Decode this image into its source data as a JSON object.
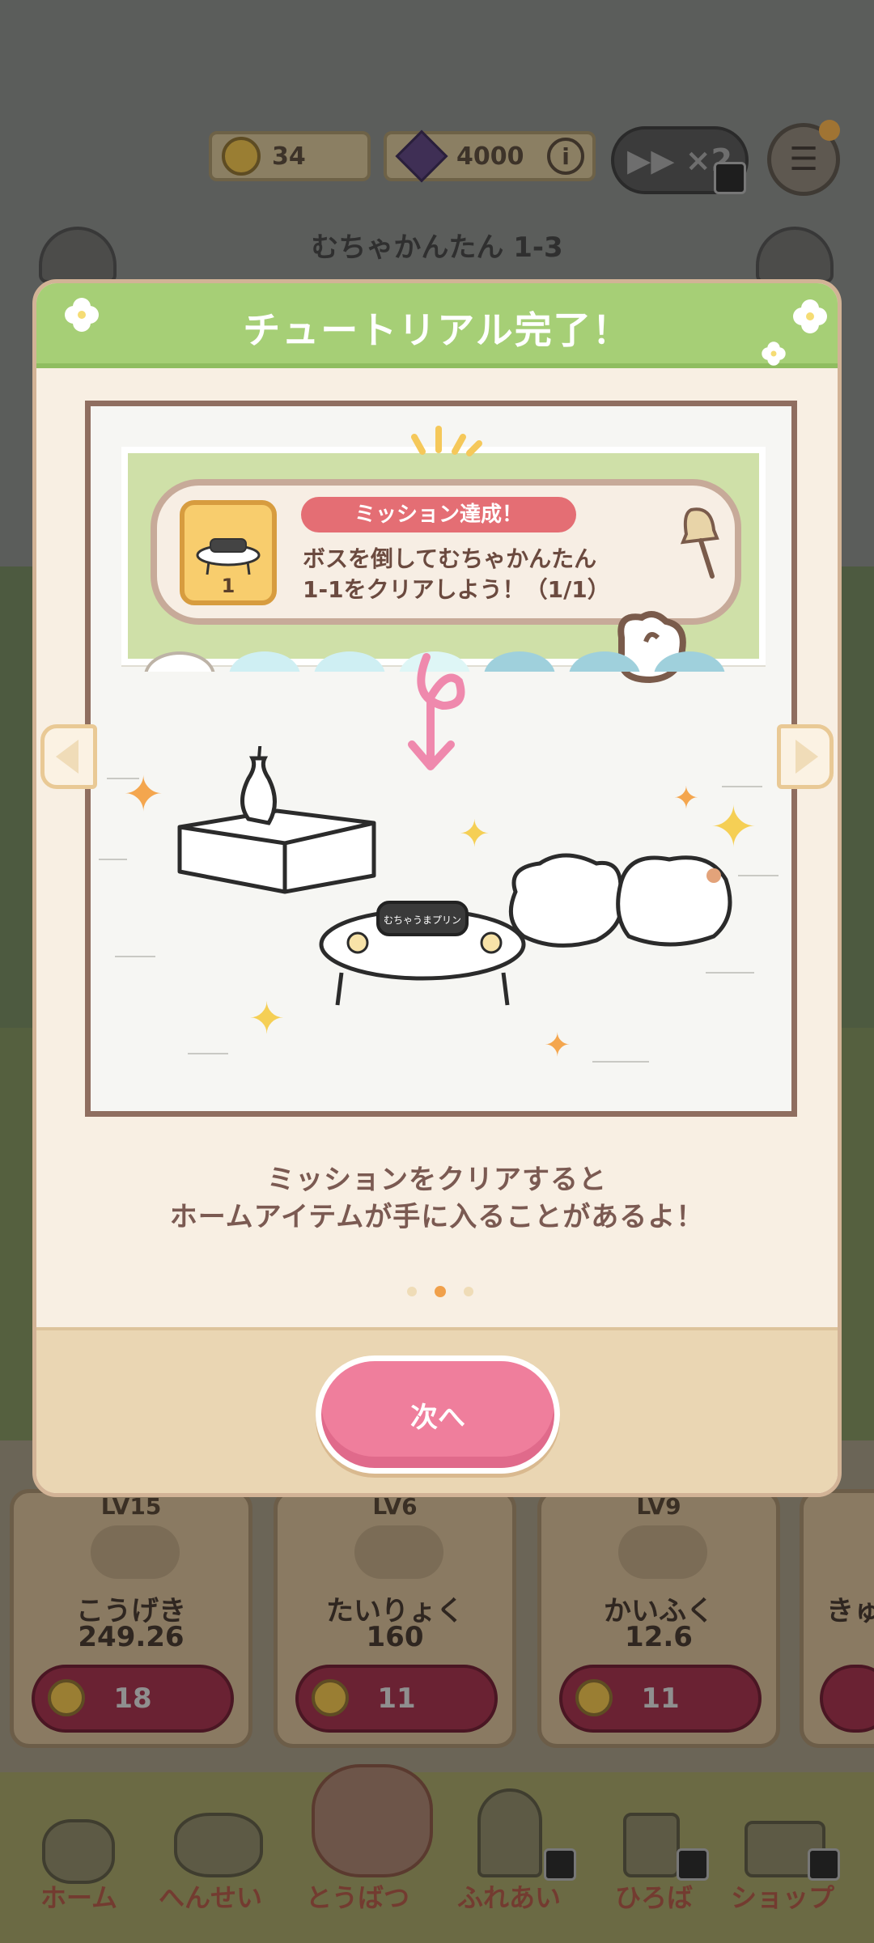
{
  "hud": {
    "coins": "34",
    "gems": "4000",
    "info_glyph": "i",
    "speed_label": "▶▶ ×2",
    "stage_title": "むちゃかんたん 1-3"
  },
  "stat_cards": [
    {
      "level": "LV15",
      "name": "こうげき",
      "value": "249.26",
      "cost": "18"
    },
    {
      "level": "LV6",
      "name": "たいりょく",
      "value": "160",
      "cost": "11"
    },
    {
      "level": "LV9",
      "name": "かいふく",
      "value": "12.6",
      "cost": "11"
    },
    {
      "level": "",
      "name": "きゅ",
      "value": "",
      "cost": ""
    }
  ],
  "bottom_nav": {
    "items": [
      {
        "label": "ホーム",
        "icon": "home-icon"
      },
      {
        "label": "へんせい",
        "icon": "party-icon"
      },
      {
        "label": "とうばつ",
        "icon": "battle-icon"
      },
      {
        "label": "ふれあい",
        "icon": "door-icon"
      },
      {
        "label": "ひろば",
        "icon": "signpost-icon"
      },
      {
        "label": "ショップ",
        "icon": "shop-icon"
      }
    ]
  },
  "modal": {
    "title": "チュートリアル完了！",
    "mission_badge": "ミッション達成！",
    "mission_line1": "ボスを倒してむちゃかんたん",
    "mission_line2": "1-1をクリアしよう！（1/1）",
    "reward_count": "1",
    "pot_label": "むちゃうまプリン",
    "hint_line1": "ミッションをクリアすると",
    "hint_line2": "ホームアイテムが手に入ることがあるよ！",
    "page_indicator": {
      "total": 3,
      "current": 2
    },
    "next_button": "次へ"
  },
  "colors": {
    "header_green": "#a6cf76",
    "button_pink": "#ef7e9c",
    "ribbon_red": "#e46e74",
    "active_dot": "#f0a04b"
  }
}
